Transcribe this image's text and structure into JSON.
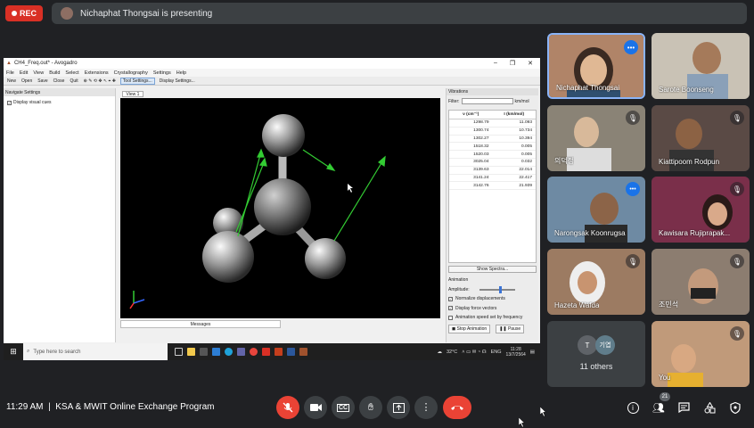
{
  "rec": {
    "label": "REC"
  },
  "presenter": {
    "text": "Nichaphat Thongsai is presenting"
  },
  "app": {
    "window_title": "CH4_Freq.out* - Avogadro",
    "menu": [
      "File",
      "Edit",
      "View",
      "Build",
      "Select",
      "Extensions",
      "Crystallography",
      "Settings",
      "Help"
    ],
    "toolbar": [
      "New",
      "Open",
      "Save",
      "Close",
      "Quit"
    ],
    "tool_settings": "Tool Settings...",
    "display_settings": "Display Settings...",
    "nav_header": "Navigate Settings",
    "display_visual_cues": "Display visual cues",
    "view_tab": "View 1",
    "messages": "Messages",
    "vibrations": {
      "header": "Vibrations",
      "filter_label": "Filter:",
      "filter_unit": "km/mol",
      "col_freq": "ν (cm⁻¹)",
      "col_int": "I (km/mol)",
      "rows": [
        [
          "1298.79",
          "11.093"
        ],
        [
          "1300.74",
          "10.734"
        ],
        [
          "1302.27",
          "10.394"
        ],
        [
          "1518.32",
          "0.005"
        ],
        [
          "1520.03",
          "0.005"
        ],
        [
          "3025.04",
          "0.032"
        ],
        [
          "3139.63",
          "22.014"
        ],
        [
          "3141.24",
          "22.417"
        ],
        [
          "3142.76",
          "21.939"
        ]
      ],
      "show_spectra": "Show Spectra...",
      "animation": "Animation",
      "amplitude": "Amplitude:",
      "normalize": "Normalize displacements",
      "force_vectors": "Display force vectors",
      "speed": "Animation speed set by frequency",
      "stop": "Stop Animation",
      "pause": "Pause"
    }
  },
  "taskbar": {
    "search_placeholder": "Type here to search",
    "temp": "32°C",
    "lang": "ENG",
    "time": "11:28",
    "date": "13/7/2564"
  },
  "participants": [
    {
      "name": "Nichaphat Thongsai",
      "bg": "#b08468"
    },
    {
      "name": "Sarote Boonseng",
      "bg": "#c9c2b5"
    },
    {
      "name": "의덕정",
      "bg": "#8a8376"
    },
    {
      "name": "Kiattipoom Rodpun",
      "bg": "#5a4a45"
    },
    {
      "name": "Narongsak Koonrugsa",
      "bg": "#6e8aa3"
    },
    {
      "name": "Kawisara Rujiprapak...",
      "bg": "#7a2f4a"
    },
    {
      "name": "Hazeta Wafda",
      "bg": "#9c7b62"
    },
    {
      "name": "조민석",
      "bg": "#8c7d70"
    },
    {
      "name": "You",
      "bg": "#c09a7a"
    }
  ],
  "others": {
    "label": "11 others",
    "initial1": "T",
    "initial2": "기엽"
  },
  "meeting": {
    "time": "11:29 AM",
    "title": "KSA & MWIT Online Exchange Program"
  },
  "people_count": "21"
}
